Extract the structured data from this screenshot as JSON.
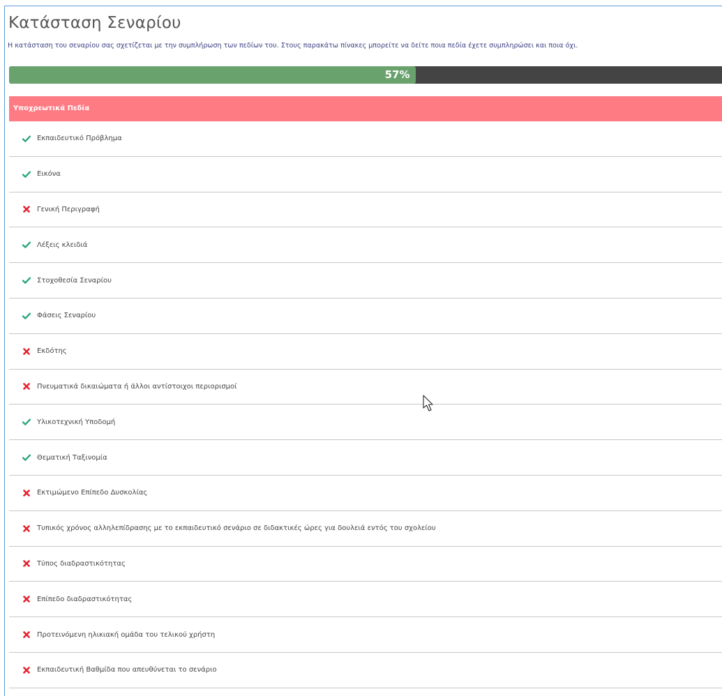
{
  "title": "Κατάσταση Σεναρίου",
  "description": "Η κατάσταση του σεναρίου σας σχετίζεται με την συμπλήρωση των πεδίων του. Στους παρακάτω πίνακες μπορείτε να δείτε ποια πεδία έχετε συμπληρώσει και ποια όχι.",
  "progress": {
    "percent": 57,
    "label": "57%",
    "fill_color": "#6aa26e",
    "track_color": "#444444"
  },
  "panel": {
    "header": "Υποχρεωτικά Πεδία",
    "header_color": "#ff7b84",
    "items": [
      {
        "label": "Εκπαιδευτικό Πρόβλημα",
        "done": true
      },
      {
        "label": "Εικόνα",
        "done": true
      },
      {
        "label": "Γενική Περιγραφή",
        "done": false
      },
      {
        "label": "Λέξεις κλειδιά",
        "done": true
      },
      {
        "label": "Στοχοθεσία Σεναρίου",
        "done": true
      },
      {
        "label": "Φάσεις Σεναρίου",
        "done": true
      },
      {
        "label": "Εκδότης",
        "done": false
      },
      {
        "label": "Πνευματικά δικαιώματα ή άλλοι αντίστοιχοι περιορισμοί",
        "done": false
      },
      {
        "label": "Υλικοτεχνική Υποδομή",
        "done": true
      },
      {
        "label": "Θεματική Ταξινομία",
        "done": true
      },
      {
        "label": "Εκτιμώμενο Επίπεδο Δυσκολίας",
        "done": false
      },
      {
        "label": "Τυπικός χρόνος αλληλεπίδρασης με το εκπαιδευτικό σενάριο σε διδακτικές ώρες για δουλειά εντός του σχολείου",
        "done": false
      },
      {
        "label": "Τύπος διαδραστικότητας",
        "done": false
      },
      {
        "label": "Επίπεδο διαδραστικότητας",
        "done": false
      },
      {
        "label": "Προτεινόμενη ηλικιακή ομάδα του τελικού χρήστη",
        "done": false
      },
      {
        "label": "Εκπαιδευτική Βαθμίδα που απευθύνεται το σενάριο",
        "done": false
      }
    ]
  },
  "icons": {
    "done": "check-icon",
    "missing": "cross-icon",
    "done_color": "#2aa57a",
    "missing_color": "#e5202e"
  }
}
